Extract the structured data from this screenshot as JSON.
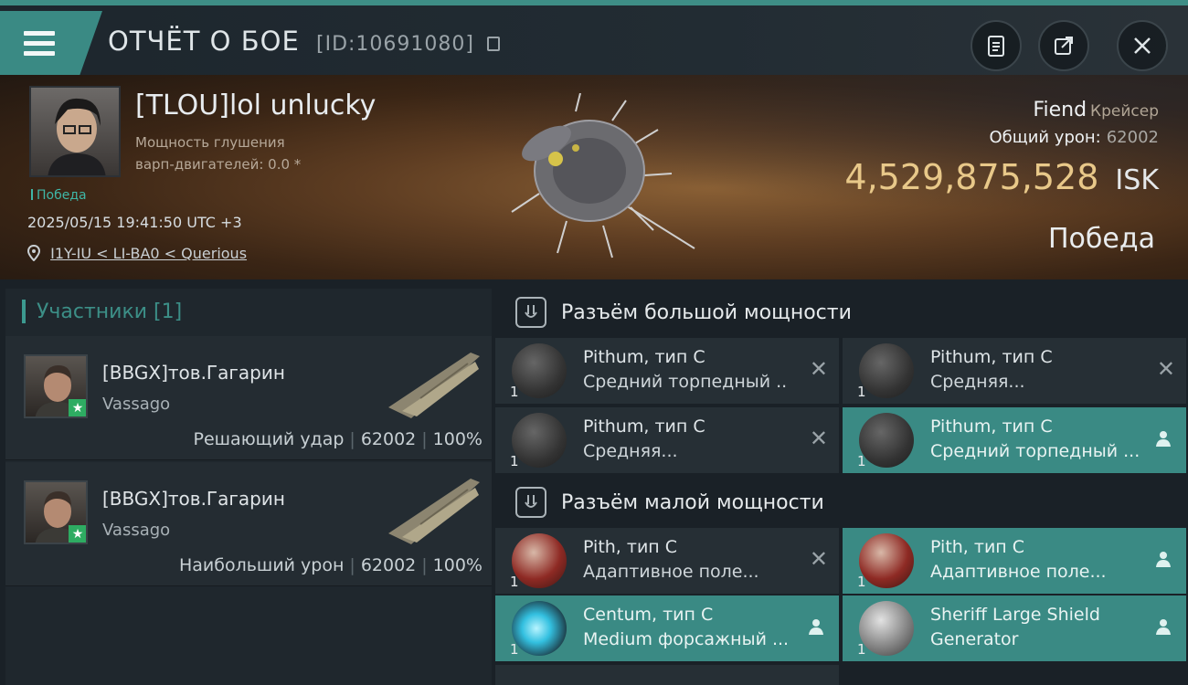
{
  "header": {
    "title": "ОТЧЁТ О БОЕ",
    "report_id": "[ID:10691080]"
  },
  "victim": {
    "pilot": "[TLOU]lol unlucky",
    "warp_line1": "Мощность глушения",
    "warp_line2": "варп-двигателей: 0.0 *",
    "result_small": "Победа",
    "timestamp": "2025/05/15 19:41:50 UTC +3",
    "location": "I1Y-IU < LI-BA0 < Querious",
    "ship_name": "Fiend",
    "ship_class": "Крейсер",
    "total_damage_label": "Общий урон:",
    "total_damage": "62002",
    "isk_value": "4,529,875,528",
    "isk_unit": "ISK",
    "result": "Победа"
  },
  "participants": {
    "header": "Участники [1]",
    "items": [
      {
        "name": "[BBGX]тов.Гагарин",
        "ship": "Vassago",
        "role": "Решающий удар",
        "damage": "62002",
        "percent": "100%"
      },
      {
        "name": "[BBGX]тов.Гагарин",
        "ship": "Vassago",
        "role": "Наибольший урон",
        "damage": "62002",
        "percent": "100%"
      }
    ]
  },
  "high_slots": {
    "title": "Разъём большой мощности",
    "modules": [
      {
        "line1": "Pithum, тип C",
        "line2": "Средний торпедный ..",
        "qty": "1",
        "state": "destroyed"
      },
      {
        "line1": "Pithum, тип C",
        "line2": "Средняя...",
        "qty": "1",
        "state": "destroyed"
      },
      {
        "line1": "Pithum, тип C",
        "line2": "Средняя...",
        "qty": "1",
        "state": "destroyed"
      },
      {
        "line1": "Pithum, тип C",
        "line2": "Средний торпедный ...",
        "qty": "1",
        "state": "dropped"
      }
    ]
  },
  "low_slots": {
    "title": "Разъём малой мощности",
    "modules": [
      {
        "line1": "Pith, тип C",
        "line2": "Адаптивное поле...",
        "qty": "1",
        "state": "destroyed"
      },
      {
        "line1": "Pith, тип C",
        "line2": "Адаптивное поле...",
        "qty": "1",
        "state": "dropped"
      },
      {
        "line1": "Centum, тип C",
        "line2": "Medium форсажный ...",
        "qty": "1",
        "state": "dropped"
      },
      {
        "line1": "Sheriff Large Shield",
        "line2": "Generator",
        "qty": "1",
        "state": "dropped"
      }
    ]
  },
  "colors": {
    "accent": "#3a8a84",
    "isk": "#e8c889",
    "star": "#2eac62"
  }
}
